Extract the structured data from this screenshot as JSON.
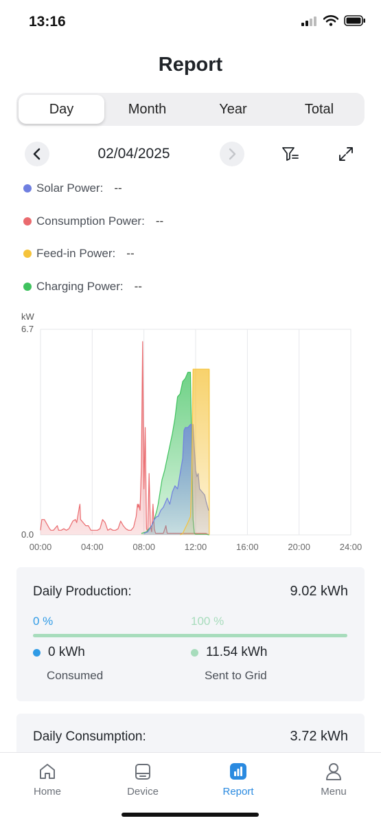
{
  "status_bar": {
    "time": "13:16"
  },
  "page": {
    "title": "Report"
  },
  "tabs": [
    {
      "label": "Day",
      "active": true
    },
    {
      "label": "Month",
      "active": false
    },
    {
      "label": "Year",
      "active": false
    },
    {
      "label": "Total",
      "active": false
    }
  ],
  "date_nav": {
    "date": "02/04/2025"
  },
  "legend": [
    {
      "label": "Solar Power:",
      "value": "--",
      "color": "#6f7fe0"
    },
    {
      "label": "Consumption Power:",
      "value": "--",
      "color": "#ea6a6e"
    },
    {
      "label": "Feed-in Power:",
      "value": "--",
      "color": "#f5c33b"
    },
    {
      "label": "Charging Power:",
      "value": "--",
      "color": "#3fc25e"
    }
  ],
  "chart_data": {
    "type": "area",
    "ylabel": "kW",
    "ylim": [
      0,
      6.7
    ],
    "ytick_labels": [
      "6.7",
      "0.0"
    ],
    "xlim": [
      0,
      24
    ],
    "xtick_labels": [
      "00:00",
      "04:00",
      "08:00",
      "12:00",
      "16:00",
      "20:00",
      "24:00"
    ],
    "grid": "vertical",
    "series": [
      {
        "name": "Consumption Power",
        "color": "#ea6a6e",
        "x": [
          0,
          0.1,
          0.3,
          0.7,
          0.8,
          1.0,
          1.3,
          1.4,
          1.6,
          1.8,
          2.0,
          2.2,
          2.5,
          2.7,
          2.8,
          3.0,
          3.05,
          3.1,
          3.3,
          3.5,
          3.7,
          3.9,
          4.2,
          4.4,
          4.6,
          4.8,
          5.0,
          5.2,
          5.4,
          5.6,
          5.8,
          6.0,
          6.2,
          6.4,
          6.6,
          6.8,
          7.0,
          7.2,
          7.4,
          7.5,
          7.55,
          7.6,
          7.7,
          7.8,
          7.9,
          8.0,
          8.1,
          8.2,
          8.3,
          8.4,
          8.5,
          8.6,
          8.7,
          8.8,
          8.9,
          9.0,
          9.1,
          9.3,
          9.5,
          9.7,
          9.8,
          9.9,
          10.1,
          10.3,
          10.5,
          10.8,
          11.0,
          11.3,
          11.6,
          12.0,
          12.4,
          12.8,
          13.05
        ],
        "y": [
          0.15,
          0.5,
          0.5,
          0.2,
          0.15,
          0.15,
          0.3,
          0.15,
          0.15,
          0.2,
          0.15,
          0.2,
          0.45,
          0.5,
          0.4,
          0.9,
          1.0,
          0.5,
          0.4,
          0.3,
          0.3,
          0.15,
          0.15,
          0.15,
          0.2,
          0.5,
          0.4,
          0.15,
          0.2,
          0.15,
          0.15,
          0.2,
          0.45,
          0.3,
          0.2,
          0.15,
          0.15,
          0.25,
          0.6,
          1.0,
          0.9,
          1.0,
          0.8,
          2.2,
          6.3,
          1.5,
          3.5,
          0.2,
          0.1,
          2.0,
          0.3,
          0.1,
          1.0,
          0.2,
          0.05,
          0.05,
          0.05,
          0.05,
          0.05,
          0.3,
          0.05,
          0.05,
          0.05,
          0.05,
          0.05,
          0.05,
          0.05,
          0.05,
          0.05,
          0.05,
          0.05,
          0.05,
          0
        ]
      },
      {
        "name": "Charging Power",
        "color": "#3fc25e",
        "x": [
          7.8,
          8.2,
          8.6,
          8.8,
          9.0,
          9.1,
          9.4,
          9.6,
          9.8,
          10.0,
          10.2,
          10.4,
          10.6,
          10.8,
          11.0,
          11.2,
          11.4,
          11.6,
          11.8,
          11.9,
          12.0,
          12.4,
          12.8,
          13.05
        ],
        "y": [
          0.05,
          0.1,
          0.3,
          0.5,
          0.8,
          1.0,
          1.8,
          2.1,
          2.5,
          2.9,
          3.3,
          3.8,
          4.5,
          4.6,
          5.0,
          5.1,
          5.3,
          5.3,
          0.5,
          0.05,
          0.02,
          0.02,
          0.02,
          0
        ]
      },
      {
        "name": "Solar Power",
        "color": "#6f7fe0",
        "x": [
          8.0,
          8.3,
          8.6,
          8.8,
          9.0,
          9.1,
          9.3,
          9.5,
          9.8,
          10.0,
          10.2,
          10.4,
          10.6,
          10.8,
          11.0,
          11.1,
          11.2,
          11.4,
          11.6,
          11.8,
          12.0,
          12.1,
          12.2,
          12.3,
          12.5,
          12.7,
          12.8,
          13.0,
          13.05
        ],
        "y": [
          0.05,
          0.1,
          0.3,
          0.5,
          0.6,
          0.6,
          0.8,
          0.9,
          1.2,
          1.0,
          1.4,
          1.6,
          1.5,
          2.0,
          2.5,
          3.4,
          3.5,
          3.5,
          3.6,
          3.6,
          2.1,
          1.9,
          2.0,
          1.5,
          1.4,
          1.3,
          1.1,
          0.8,
          0.8
        ]
      },
      {
        "name": "Feed-in Power",
        "color": "#f5c33b",
        "x": [
          10.8,
          11.0,
          11.4,
          11.6,
          11.7,
          11.8,
          11.9,
          13.05,
          13.05
        ],
        "y": [
          0,
          0.05,
          0.4,
          0.6,
          2.0,
          5.4,
          5.4,
          5.4,
          0
        ]
      }
    ]
  },
  "cards": [
    {
      "label": "Daily Production:",
      "value": "9.02 kWh",
      "left_pct": "0 %",
      "right_pct": "100 %",
      "progress": 1.0,
      "left_color": "#2f9be6",
      "right_color": "#a7dcbc",
      "left_stat": {
        "value": "0 kWh",
        "caption": "Consumed"
      },
      "right_stat": {
        "value": "11.54 kWh",
        "caption": "Sent to Grid"
      }
    },
    {
      "label": "Daily Consumption:",
      "value": "3.72 kWh"
    }
  ],
  "tabbar": [
    {
      "label": "Home",
      "icon": "home-icon",
      "active": false
    },
    {
      "label": "Device",
      "icon": "device-icon",
      "active": false
    },
    {
      "label": "Report",
      "icon": "report-icon",
      "active": true
    },
    {
      "label": "Menu",
      "icon": "user-icon",
      "active": false
    }
  ],
  "accent_color": "#2a8ae0"
}
